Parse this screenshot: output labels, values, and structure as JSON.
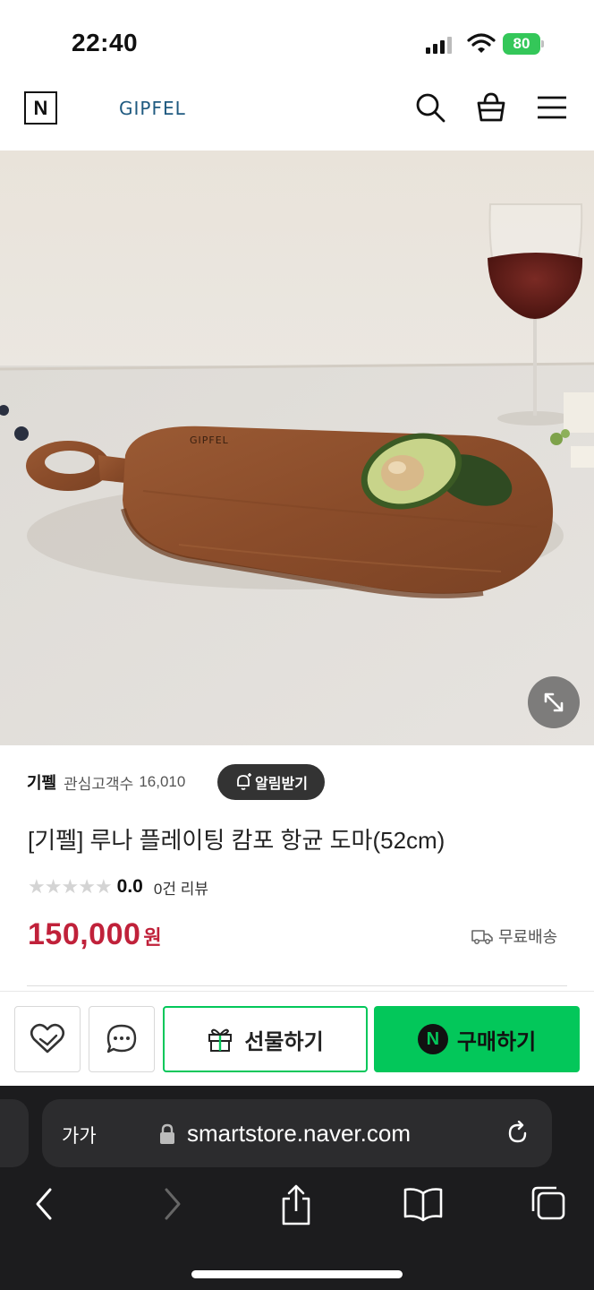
{
  "status_bar": {
    "time": "22:40",
    "battery": "80"
  },
  "header": {
    "brand_mark": "N",
    "store_logo": "GIPFEL"
  },
  "hero": {
    "wordmark": "GIPFEL"
  },
  "product": {
    "store_name": "기펠",
    "follower_label": "관심고객수",
    "follower_count": "16,010",
    "alert_label": "알림받기",
    "title": "[기펠] 루나 플레이팅 캄포 항균 도마(52cm)",
    "rating": 0.0,
    "rating_text": "0.0",
    "review_count": "0건 리뷰",
    "price": "150,000",
    "currency": "원",
    "shipping": "무료배송"
  },
  "actions": {
    "gift_label": "선물하기",
    "buy_badge": "N",
    "buy_label": "구매하기"
  },
  "browser": {
    "text_size_label": "가가",
    "url": "smartstore.naver.com"
  },
  "colors": {
    "naver_green": "#03c75a",
    "price_red": "#c0213a",
    "battery_green": "#34c759"
  },
  "icons": [
    "search-icon",
    "cart-icon",
    "menu-icon",
    "expand-icon",
    "bell-icon",
    "heart-icon",
    "chat-icon",
    "gift-icon",
    "truck-icon",
    "lock-icon",
    "reload-icon",
    "back-icon",
    "forward-icon",
    "share-icon",
    "bookmarks-icon",
    "tabs-icon"
  ]
}
